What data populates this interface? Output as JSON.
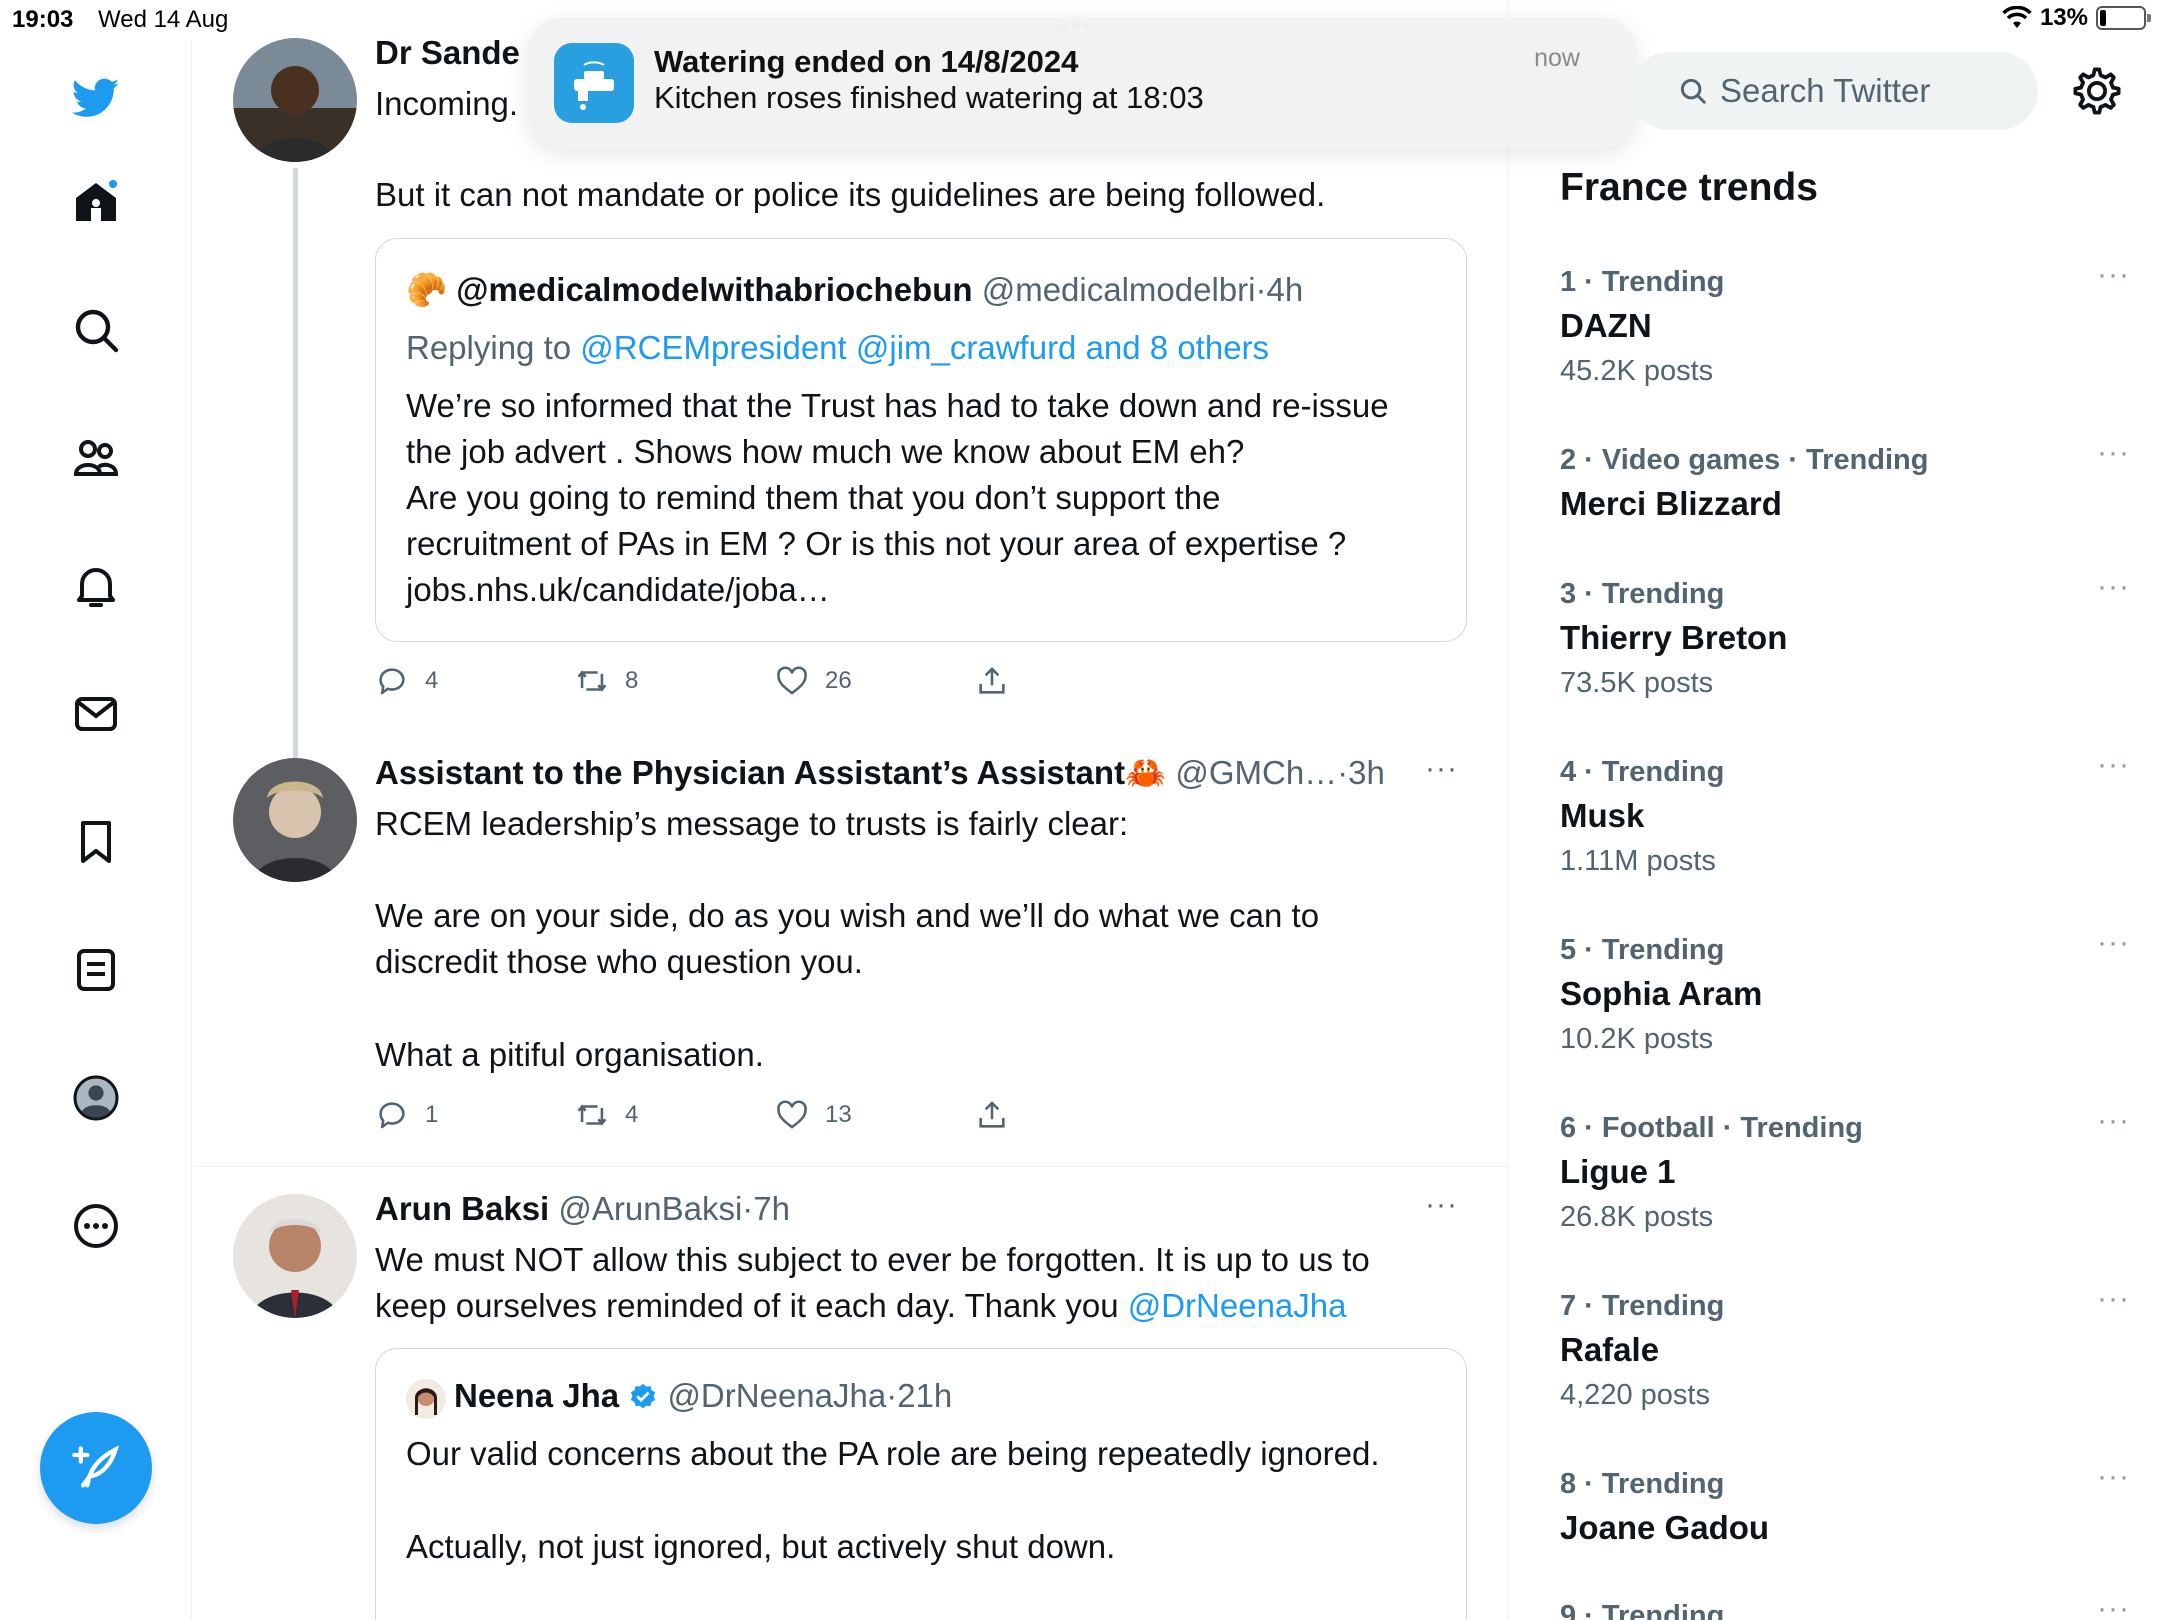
{
  "status_bar": {
    "time": "19:03",
    "date": "Wed 14 Aug",
    "battery": "13%",
    "grabber": "•••"
  },
  "nav": {
    "items": [
      "home-icon",
      "search-icon",
      "communities-icon",
      "notifications-icon",
      "messages-icon",
      "bookmarks-icon",
      "lists-icon",
      "profile-icon",
      "more-icon"
    ],
    "compose": "compose-tweet-icon",
    "accent": "#1d9bf0"
  },
  "notification": {
    "title": "Watering ended on 14/8/2024",
    "body": "Kitchen roses finished watering at 18:03",
    "time": "now"
  },
  "tweets": [
    {
      "author": "Dr Sande",
      "line1": "Incoming.",
      "text": "But it can not mandate or police its guidelines are being followed.",
      "quote": {
        "emoji": "🥐",
        "name": "@medicalmodelwithabriochebun",
        "handle": "@medicalmodelbri",
        "sep": "·",
        "time": "4h",
        "replying_prefix": "Replying to",
        "replying_to": "@RCEMpresident @jim_crawfurd and 8 others",
        "lines": [
          "We’re so informed that the Trust has had to take down and re-issue",
          "the job advert . Shows how much we know about EM eh?",
          "Are you going to remind them that you don’t support the",
          "recruitment of PAs in EM ? Or is this  not your area of expertise ?",
          "jobs.nhs.uk/candidate/joba…"
        ]
      },
      "replies": "4",
      "retweets": "8",
      "likes": "26"
    },
    {
      "author": "Assistant to the Physician Assistant’s Assistant",
      "emoji": "🦀",
      "handle": "@GMCh…",
      "sep": "·",
      "time": "3h",
      "lines": [
        "RCEM leadership’s message to trusts is fairly clear:",
        "We are on your side, do as you wish and we’ll do what we can to",
        "discredit those who question you.",
        "What a pitiful organisation."
      ],
      "replies": "1",
      "retweets": "4",
      "likes": "13"
    },
    {
      "author": "Arun Baksi",
      "handle": "@ArunBaksi",
      "sep": "·",
      "time": "7h",
      "line1": "We must NOT allow this subject to ever be forgotten. It is up to us to",
      "line2_prefix": "keep ourselves reminded of it each day. Thank you ",
      "line2_mention": "@DrNeenaJha",
      "quote": {
        "name": "Neena Jha",
        "handle": "@DrNeenaJha",
        "sep": "·",
        "time": "21h",
        "lines": [
          "Our valid concerns about the PA role are being repeatedly ignored.",
          "Actually, not just ignored, but actively shut down."
        ]
      }
    }
  ],
  "sidebar": {
    "search_placeholder": "Search Twitter",
    "title": "France trends",
    "trends": [
      {
        "meta": "1 · Trending",
        "name": "DAZN",
        "count": "45.2K posts"
      },
      {
        "meta": "2 · Video games · Trending",
        "name": "Merci Blizzard",
        "count": ""
      },
      {
        "meta": "3 · Trending",
        "name": "Thierry Breton",
        "count": "73.5K posts"
      },
      {
        "meta": "4 · Trending",
        "name": "Musk",
        "count": "1.11M posts"
      },
      {
        "meta": "5 · Trending",
        "name": "Sophia Aram",
        "count": "10.2K posts"
      },
      {
        "meta": "6 · Football · Trending",
        "name": "Ligue 1",
        "count": "26.8K posts"
      },
      {
        "meta": "7 · Trending",
        "name": "Rafale",
        "count": "4,220 posts"
      },
      {
        "meta": "8 · Trending",
        "name": "Joane Gadou",
        "count": ""
      },
      {
        "meta": "9 · Trending",
        "name": "",
        "count": ""
      }
    ]
  },
  "more_glyph": "···"
}
